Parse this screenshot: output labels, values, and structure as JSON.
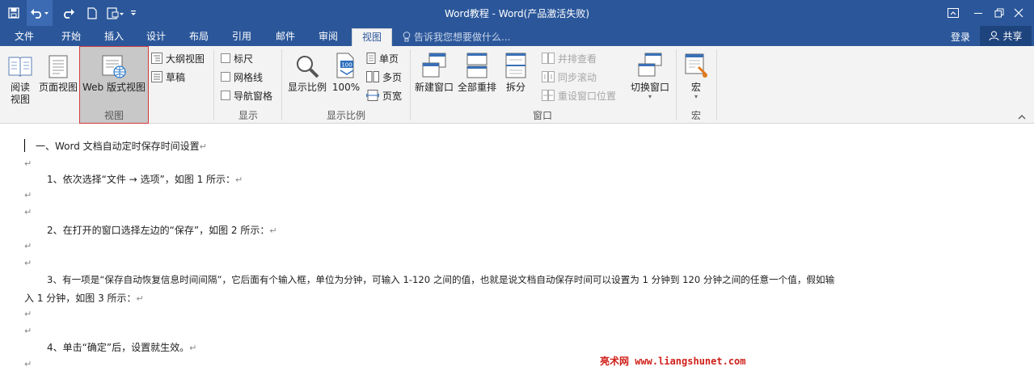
{
  "titlebar": {
    "title": "Word教程 - Word(产品激活失败)",
    "colors": {
      "bg": "#2b579a",
      "fg": "#ffffff"
    },
    "qat_icons": [
      "save-icon",
      "undo-icon",
      "redo-icon",
      "new-document-icon",
      "touch-mode-icon",
      "customize-qat-icon"
    ],
    "window_icons": [
      "ribbon-display-options-icon",
      "minimize-icon",
      "restore-icon",
      "close-icon"
    ]
  },
  "tabs": {
    "items": [
      "文件",
      "开始",
      "插入",
      "设计",
      "布局",
      "引用",
      "邮件",
      "审阅",
      "视图"
    ],
    "active": "视图",
    "tellme": "告诉我您想要做什么...",
    "login": "登录",
    "share": "共享"
  },
  "ribbon": {
    "views": {
      "group": "视图",
      "read_mode": "阅读\n视图",
      "print_layout": "页面视图",
      "web_layout": "Web 版式视图",
      "outline": "大纲视图",
      "draft": "草稿"
    },
    "show": {
      "group": "显示",
      "ruler": "标尺",
      "gridlines": "网格线",
      "nav_pane": "导航窗格"
    },
    "zoom": {
      "group": "显示比例",
      "zoom": "显示比例",
      "percent": "100%",
      "one_page": "单页",
      "multi_page": "多页",
      "page_width": "页宽"
    },
    "window": {
      "group": "窗口",
      "new_window": "新建窗口",
      "arrange_all": "全部重排",
      "split": "拆分",
      "side_by_side": "并排查看",
      "sync_scroll": "同步滚动",
      "reset_position": "重设窗口位置",
      "switch_windows": "切换窗口"
    },
    "macros": {
      "group": "宏",
      "macros": "宏"
    }
  },
  "document": {
    "heading": "一、Word 文档自动定时保存时间设置",
    "p1": "1、依次选择“文件 → 选项”，如图 1 所示：",
    "p2": "2、在打开的窗口选择左边的“保存”，如图 2 所示：",
    "p3a": "3、有一项是“保存自动恢复信息时间间隔”，它后面有个输入框，单位为分钟，可输入 1-120 之间的值，也就是说文档自动保存时间可以设置为 1 分钟到 120 分钟之间的任意一个值，假如输",
    "p3b": "入 1 分钟，如图 3 所示：",
    "p4": "4、单击“确定”后，设置就生效。",
    "paragraph_mark": "↵",
    "watermark": "亮术网 www.liangshunet.com"
  }
}
